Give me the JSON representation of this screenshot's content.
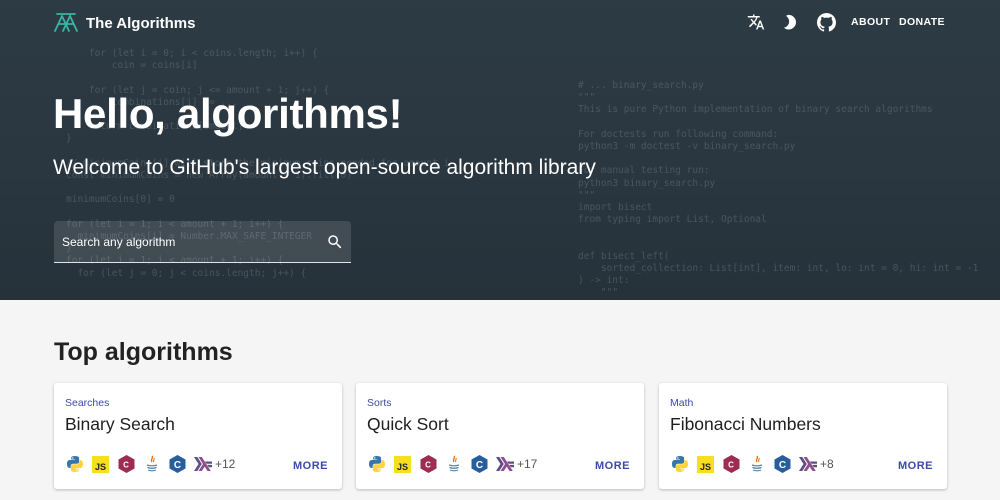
{
  "header": {
    "brand": "The Algorithms",
    "logo_icon": "the-algorithms-logo",
    "nav_icons": [
      "translate-icon",
      "dark-mode-icon",
      "github-icon"
    ],
    "nav_links": [
      "ABOUT",
      "DONATE"
    ]
  },
  "hero": {
    "title": "Hello, algorithms!",
    "subtitle": "Welcome to GitHub's largest open-source algorithm library",
    "search_placeholder": "Search any algorithm"
  },
  "top": {
    "title": "Top algorithms",
    "cards": [
      {
        "category": "Searches",
        "title": "Binary Search",
        "more_count": "+12",
        "more_label": "MORE"
      },
      {
        "category": "Sorts",
        "title": "Quick Sort",
        "more_count": "+17",
        "more_label": "MORE"
      },
      {
        "category": "Math",
        "title": "Fibonacci Numbers",
        "more_count": "+8",
        "more_label": "MORE"
      }
    ],
    "language_icons": [
      "python-icon",
      "javascript-icon",
      "cplusplus-icon",
      "java-icon",
      "c-icon",
      "haskell-icon"
    ]
  },
  "colors": {
    "hero_bg": "#2d3b45",
    "accent": "#3b4aa8",
    "logo": "#39b5a4"
  }
}
